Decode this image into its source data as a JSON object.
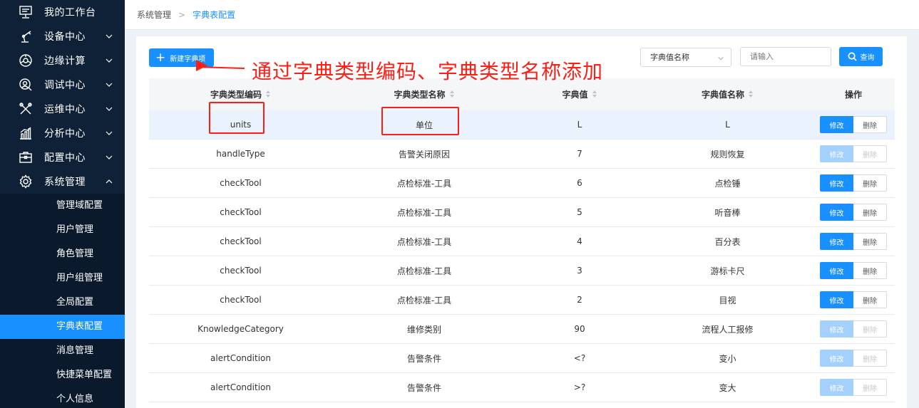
{
  "sidebar": {
    "items": [
      {
        "label": "我的工作台",
        "icon": "monitor-icon",
        "chevron": ""
      },
      {
        "label": "设备中心",
        "icon": "robot-arm-icon",
        "chevron": "down"
      },
      {
        "label": "边缘计算",
        "icon": "edge-compute-icon",
        "chevron": "down"
      },
      {
        "label": "调试中心",
        "icon": "debug-icon",
        "chevron": "down"
      },
      {
        "label": "运维中心",
        "icon": "tools-icon",
        "chevron": "down"
      },
      {
        "label": "分析中心",
        "icon": "bar-chart-icon",
        "chevron": "down"
      },
      {
        "label": "配置中心",
        "icon": "toolbox-icon",
        "chevron": "down"
      },
      {
        "label": "系统管理",
        "icon": "gear-icon",
        "chevron": "up"
      }
    ],
    "subitems": [
      "管理域配置",
      "用户管理",
      "角色管理",
      "用户组管理",
      "全局配置",
      "字典表配置",
      "消息管理",
      "快捷菜单配置",
      "个人信息"
    ],
    "active_subitem": "字典表配置"
  },
  "breadcrumb": {
    "root": "系统管理",
    "separator": ">",
    "current": "字典表配置"
  },
  "toolbar": {
    "new_label": "新建字典项",
    "select_value": "字典值名称",
    "search_placeholder": "请输入",
    "query_label": "查询"
  },
  "annotation": "通过字典类型编码、字典类型名称添加",
  "table": {
    "headers": [
      "字典类型编码",
      "字典类型名称",
      "字典值",
      "字典值名称",
      "操作"
    ],
    "edit_label": "修改",
    "delete_label": "删除",
    "rows": [
      {
        "code": "units",
        "name": "单位",
        "value": "L",
        "value_name": "L",
        "enabled": true
      },
      {
        "code": "handleType",
        "name": "告警关闭原因",
        "value": "7",
        "value_name": "规则恢复",
        "enabled": false
      },
      {
        "code": "checkTool",
        "name": "点检标准-工具",
        "value": "6",
        "value_name": "点检锤",
        "enabled": true
      },
      {
        "code": "checkTool",
        "name": "点检标准-工具",
        "value": "5",
        "value_name": "听音棒",
        "enabled": true
      },
      {
        "code": "checkTool",
        "name": "点检标准-工具",
        "value": "4",
        "value_name": "百分表",
        "enabled": true
      },
      {
        "code": "checkTool",
        "name": "点检标准-工具",
        "value": "3",
        "value_name": "游标卡尺",
        "enabled": true
      },
      {
        "code": "checkTool",
        "name": "点检标准-工具",
        "value": "2",
        "value_name": "目视",
        "enabled": true
      },
      {
        "code": "KnowledgeCategory",
        "name": "维修类别",
        "value": "90",
        "value_name": "流程人工报修",
        "enabled": false
      },
      {
        "code": "alertCondition",
        "name": "告警条件",
        "value": "<?",
        "value_name": "变小",
        "enabled": false
      },
      {
        "code": "alertCondition",
        "name": "告警条件",
        "value": ">?",
        "value_name": "变大",
        "enabled": false
      }
    ]
  },
  "colors": {
    "sidebar_bg": "#0f2136",
    "accent": "#1890ff",
    "annotation": "#ff1d14"
  }
}
